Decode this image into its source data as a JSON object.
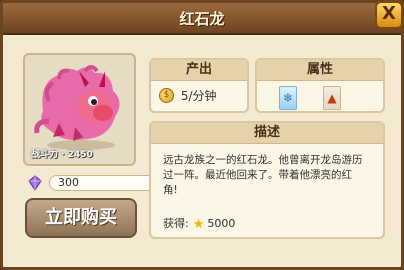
{
  "title": "红石龙",
  "close_label": "X",
  "portrait": {
    "level_text": "战斗力 · 2450"
  },
  "price": {
    "value": "300",
    "icon": "gem-icon"
  },
  "buy_button": "立即购买",
  "output": {
    "header": "产出",
    "value": "5/分钟",
    "icon": "coin-icon"
  },
  "attributes": {
    "header": "属性",
    "items": [
      "ice-icon",
      "fire-icon"
    ]
  },
  "description": {
    "header": "描述",
    "text": "远古龙族之一的红石龙。他曾离开龙岛游历过一阵。最近他回来了。带着他漂亮的红角!",
    "reward_label": "获得:",
    "reward_value": "5000",
    "reward_icon": "star-icon"
  }
}
